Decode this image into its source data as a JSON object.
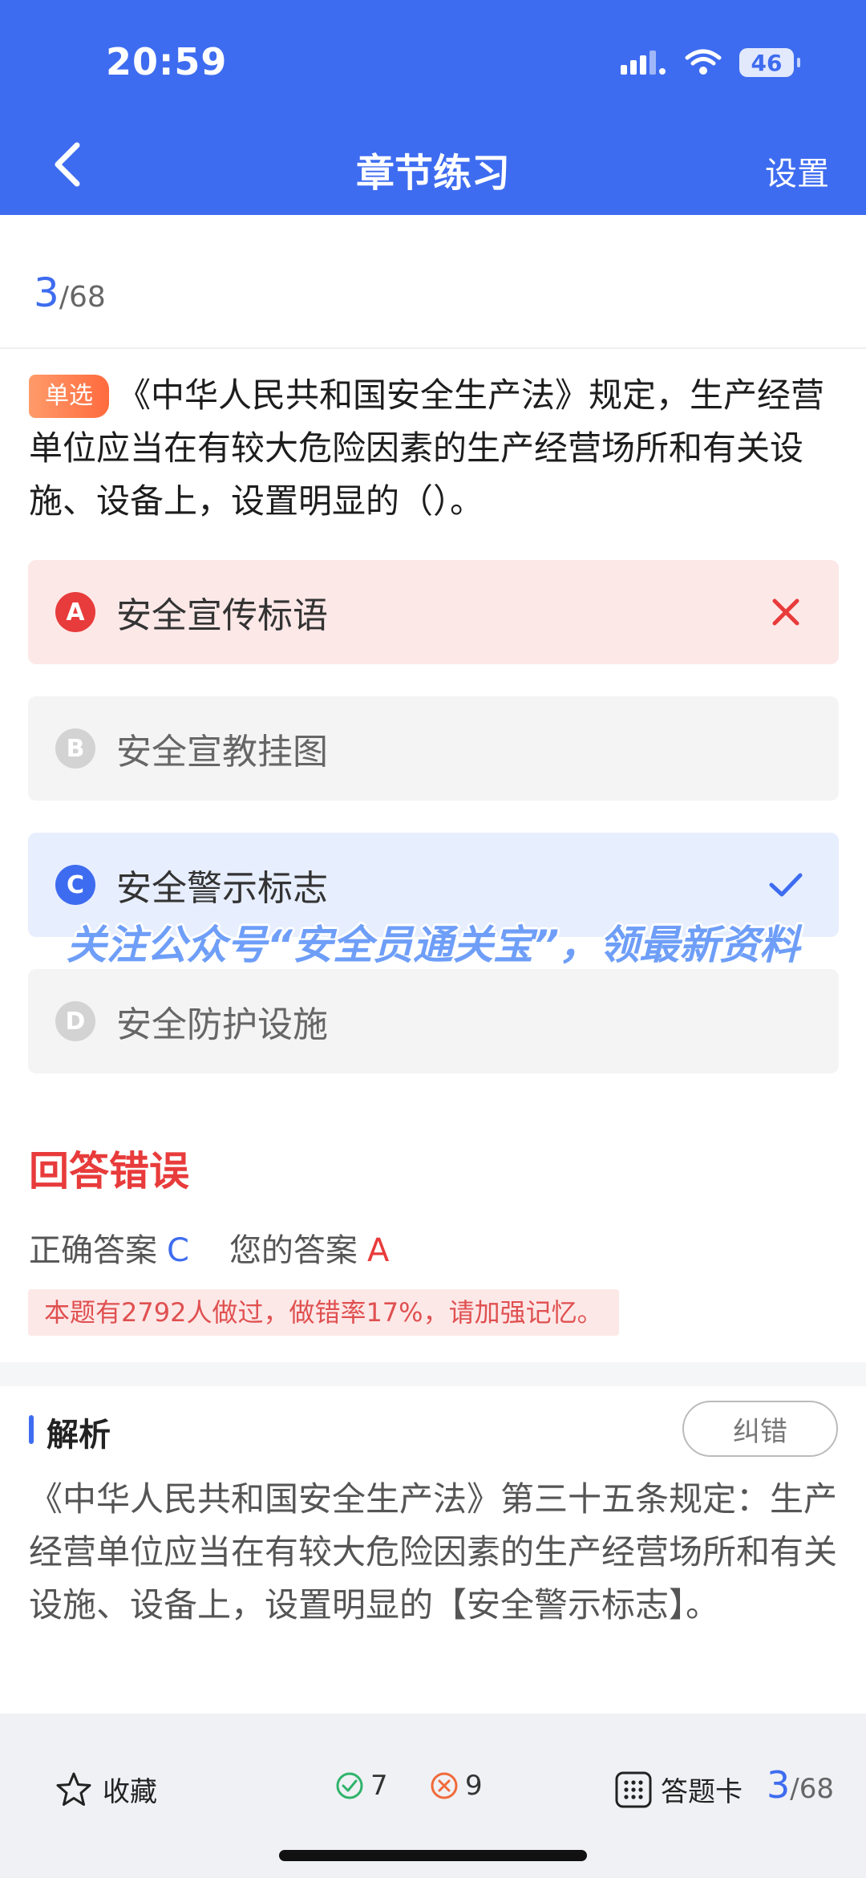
{
  "status": {
    "time": "20:59",
    "battery": "46"
  },
  "nav": {
    "title": "章节练习",
    "settings": "设置"
  },
  "progress": {
    "current": "3",
    "total": "/68"
  },
  "question": {
    "type": "单选",
    "text": "《中华人民共和国安全生产法》规定，生产经营单位应当在有较大危险因素的生产经营场所和有关设施、设备上，设置明显的（）。"
  },
  "options": [
    {
      "letter": "A",
      "text": "安全宣传标语",
      "state": "wrong"
    },
    {
      "letter": "B",
      "text": "安全宣教挂图",
      "state": "normal"
    },
    {
      "letter": "C",
      "text": "安全警示标志",
      "state": "correct"
    },
    {
      "letter": "D",
      "text": "安全防护设施",
      "state": "normal"
    }
  ],
  "watermark": "关注公众号“安全员通关宝”，领最新资料",
  "result": {
    "title": "回答错误",
    "correct_label": "正确答案",
    "correct_value": "C",
    "your_label": "您的答案",
    "your_value": "A",
    "note": "本题有2792人做过，做错率17%，请加强记忆。"
  },
  "analysis": {
    "title": "解析",
    "report_button": "纠错",
    "text": "《中华人民共和国安全生产法》第三十五条规定：生产经营单位应当在有较大危险因素的生产经营场所和有关设施、设备上，设置明显的【安全警示标志】。"
  },
  "bottom": {
    "favorite": "收藏",
    "right_count": "7",
    "wrong_count": "9",
    "answer_card": "答题卡",
    "page_current": "3",
    "page_total": "/68"
  },
  "colors": {
    "primary": "#3e6cf0",
    "error": "#e83b3b",
    "tag": "#ff7a45"
  }
}
